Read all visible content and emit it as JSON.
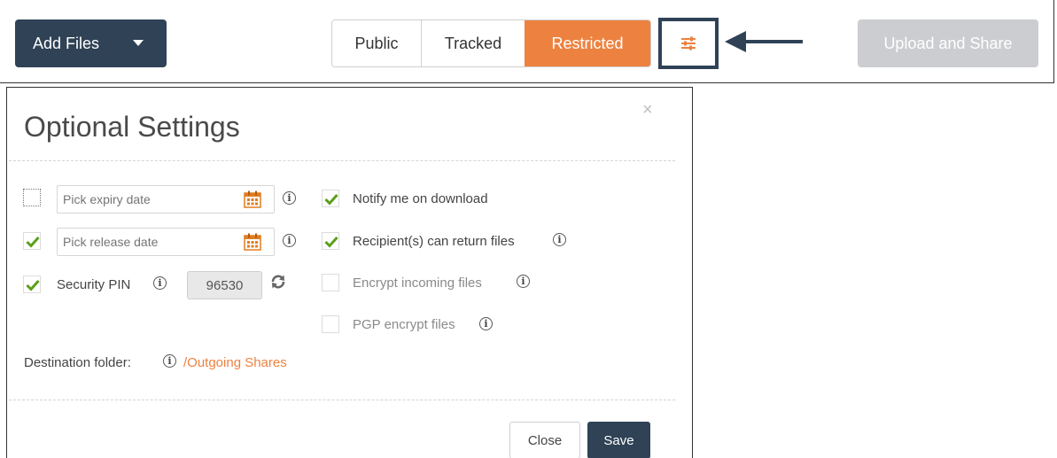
{
  "toolbar": {
    "add_files_label": "Add Files",
    "share_modes": [
      "Public",
      "Tracked",
      "Restricted"
    ],
    "selected_mode": "Restricted",
    "upload_label": "Upload and Share",
    "settings_icon": "sliders-icon"
  },
  "modal": {
    "title": "Optional Settings",
    "close_glyph": "×",
    "expiry": {
      "checked": false,
      "placeholder": "Pick expiry date"
    },
    "release": {
      "checked": true,
      "placeholder": "Pick release date"
    },
    "security_pin": {
      "checked": true,
      "label": "Security PIN",
      "value": "96530"
    },
    "notify": {
      "checked": true,
      "label": "Notify me on download"
    },
    "return_files": {
      "checked": true,
      "label": "Recipient(s) can return files"
    },
    "encrypt_incoming": {
      "checked": false,
      "enabled": false,
      "label": "Encrypt incoming files"
    },
    "pgp_encrypt": {
      "checked": false,
      "enabled": false,
      "label": "PGP encrypt files"
    },
    "destination": {
      "label": "Destination folder:",
      "path": "/Outgoing Shares"
    },
    "close_label": "Close",
    "save_label": "Save",
    "info_glyph": "i"
  },
  "colors": {
    "navy": "#2f4256",
    "accent": "#ed8240",
    "check": "#5c9e1a",
    "disabled": "#cbcdd0"
  }
}
